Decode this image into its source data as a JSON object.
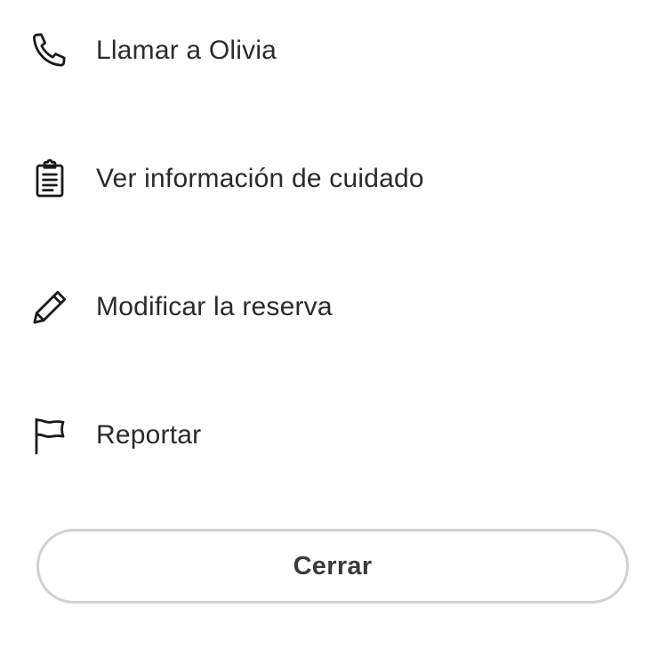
{
  "menu": {
    "items": [
      {
        "label": "Llamar a Olivia",
        "icon": "phone-icon"
      },
      {
        "label": "Ver información de cuidado",
        "icon": "clipboard-icon"
      },
      {
        "label": "Modificar la reserva",
        "icon": "pencil-icon"
      },
      {
        "label": "Reportar",
        "icon": "flag-icon"
      }
    ]
  },
  "close_button": {
    "label": "Cerrar"
  },
  "colors": {
    "text": "#2b2b2b",
    "icon": "#1a1a1a",
    "button_border": "#cfd1d6",
    "background": "#ffffff"
  }
}
